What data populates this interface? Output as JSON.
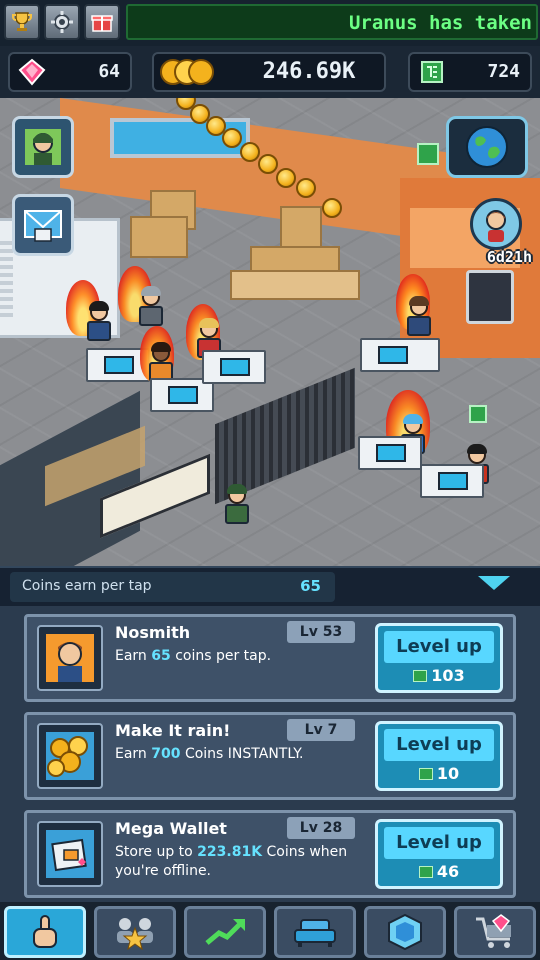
{
  "ticker": {
    "text": "Uranus has taken"
  },
  "top_icons": [
    "trophy-icon",
    "gear-icon",
    "gift-icon"
  ],
  "currency": {
    "gems": "64",
    "coins": "246.69K",
    "chips": "724"
  },
  "event": {
    "timer": "6d21h"
  },
  "coins_per_tap": {
    "label": "Coins earn per tap",
    "value": "65"
  },
  "upgrades": [
    {
      "name": "Nosmith",
      "level": "Lv 53",
      "desc_pre": "Earn ",
      "desc_highlight": "65",
      "desc_post": " coins per tap.",
      "button": "Level up",
      "cost": "103",
      "icon": "character-portrait-icon"
    },
    {
      "name": "Make It rain!",
      "level": "Lv 7",
      "desc_pre": "Earn ",
      "desc_highlight": "700",
      "desc_post": " Coins INSTANTLY.",
      "button": "Level up",
      "cost": "10",
      "icon": "coin-pile-icon"
    },
    {
      "name": "Mega Wallet",
      "level": "Lv 28",
      "desc_pre": "Store up to ",
      "desc_highlight": "223.81K",
      "desc_post": " Coins when you're offline.",
      "button": "Level up",
      "cost": "46",
      "icon": "wallet-icon"
    }
  ],
  "nav": [
    "tap-hand-icon",
    "team-icon",
    "growth-icon",
    "sofa-icon",
    "cube-icon",
    "shop-cart-icon"
  ],
  "colors": {
    "accent": "#58d7ff",
    "ticker_text": "#6cff84",
    "highlight": "#66e2ff"
  }
}
